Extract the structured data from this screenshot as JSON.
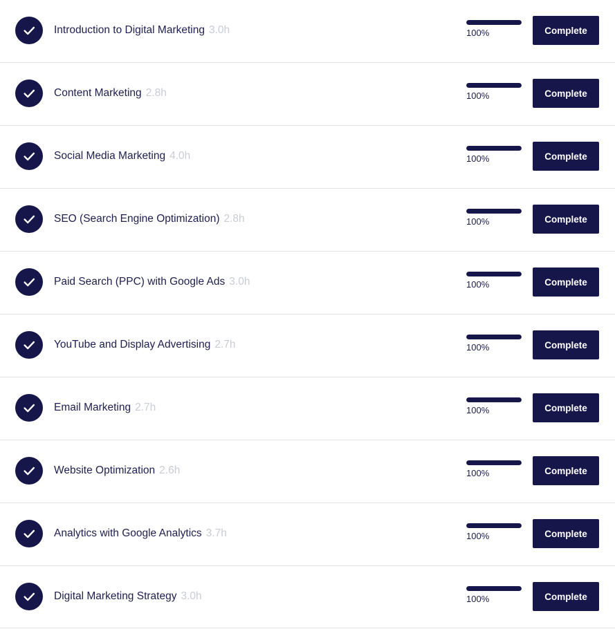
{
  "colors": {
    "navy": "#16164a",
    "text": "#1e1e50",
    "muted": "#c9ccd6",
    "divider": "#e2e2e6",
    "button_text": "#ffffff"
  },
  "icons": {
    "status": "check-circle-icon"
  },
  "courses": [
    {
      "title": "Introduction to Digital Marketing",
      "hours": "3.0h",
      "progress": 100,
      "progress_label": "100%",
      "button_label": "Complete"
    },
    {
      "title": "Content Marketing",
      "hours": "2.8h",
      "progress": 100,
      "progress_label": "100%",
      "button_label": "Complete"
    },
    {
      "title": "Social Media Marketing",
      "hours": "4.0h",
      "progress": 100,
      "progress_label": "100%",
      "button_label": "Complete"
    },
    {
      "title": "SEO (Search Engine Optimization)",
      "hours": "2.8h",
      "progress": 100,
      "progress_label": "100%",
      "button_label": "Complete"
    },
    {
      "title": "Paid Search (PPC) with Google Ads",
      "hours": "3.0h",
      "progress": 100,
      "progress_label": "100%",
      "button_label": "Complete"
    },
    {
      "title": "YouTube and Display Advertising",
      "hours": "2.7h",
      "progress": 100,
      "progress_label": "100%",
      "button_label": "Complete"
    },
    {
      "title": "Email Marketing",
      "hours": "2.7h",
      "progress": 100,
      "progress_label": "100%",
      "button_label": "Complete"
    },
    {
      "title": "Website Optimization",
      "hours": "2.6h",
      "progress": 100,
      "progress_label": "100%",
      "button_label": "Complete"
    },
    {
      "title": "Analytics with Google Analytics",
      "hours": "3.7h",
      "progress": 100,
      "progress_label": "100%",
      "button_label": "Complete"
    },
    {
      "title": "Digital Marketing Strategy",
      "hours": "3.0h",
      "progress": 100,
      "progress_label": "100%",
      "button_label": "Complete"
    }
  ]
}
